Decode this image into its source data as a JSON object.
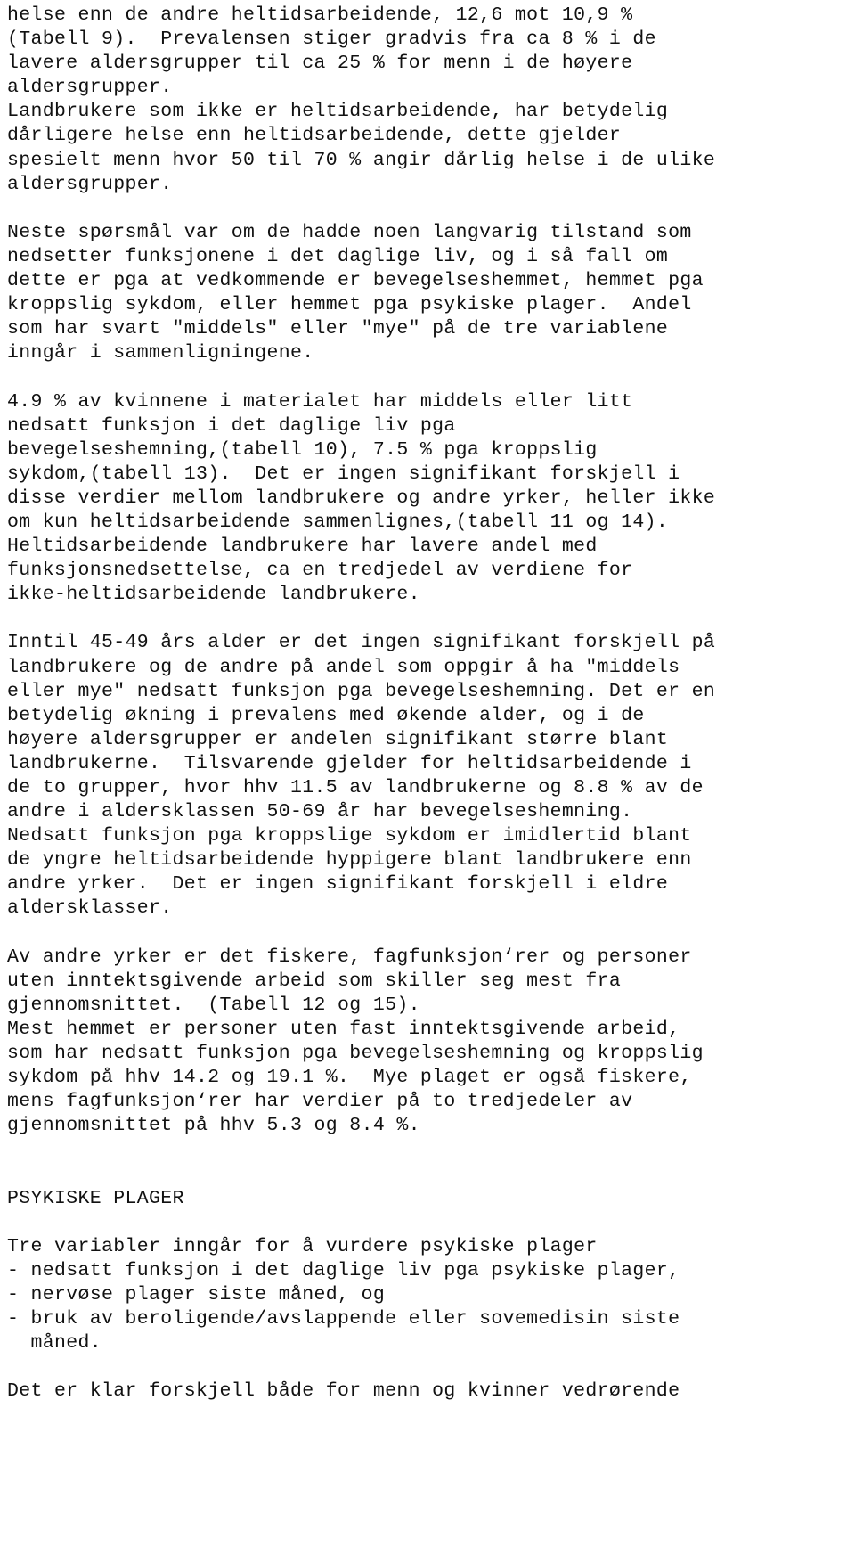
{
  "document": {
    "type": "scanned-report-page",
    "language": "no",
    "section_heading": "PSYKISKE PLAGER",
    "lines": [
      "helse enn de andre heltidsarbeidende, 12,6 mot 10,9 %",
      "(Tabell 9).  Prevalensen stiger gradvis fra ca 8 % i de",
      "lavere aldersgrupper til ca 25 % for menn i de høyere",
      "aldersgrupper.",
      "Landbrukere som ikke er heltidsarbeidende, har betydelig",
      "dårligere helse enn heltidsarbeidende, dette gjelder",
      "spesielt menn hvor 50 til 70 % angir dårlig helse i de ulike",
      "aldersgrupper.",
      "",
      "Neste spørsmål var om de hadde noen langvarig tilstand som",
      "nedsetter funksjonene i det daglige liv, og i så fall om",
      "dette er pga at vedkommende er bevegelseshemmet, hemmet pga",
      "kroppslig sykdom, eller hemmet pga psykiske plager.  Andel",
      "som har svart \"middels\" eller \"mye\" på de tre variablene",
      "inngår i sammenligningene.",
      "",
      "4.9 % av kvinnene i materialet har middels eller litt",
      "nedsatt funksjon i det daglige liv pga",
      "bevegelseshemning,(tabell 10), 7.5 % pga kroppslig",
      "sykdom,(tabell 13).  Det er ingen signifikant forskjell i",
      "disse verdier mellom landbrukere og andre yrker, heller ikke",
      "om kun heltidsarbeidende sammenlignes,(tabell 11 og 14).",
      "Heltidsarbeidende landbrukere har lavere andel med",
      "funksjonsnedsettelse, ca en tredjedel av verdiene for",
      "ikke-heltidsarbeidende landbrukere.",
      "",
      "Inntil 45-49 års alder er det ingen signifikant forskjell på",
      "landbrukere og de andre på andel som oppgir å ha \"middels",
      "eller mye\" nedsatt funksjon pga bevegelseshemning. Det er en",
      "betydelig økning i prevalens med økende alder, og i de",
      "høyere aldersgrupper er andelen signifikant større blant",
      "landbrukerne.  Tilsvarende gjelder for heltidsarbeidende i",
      "de to grupper, hvor hhv 11.5 av landbrukerne og 8.8 % av de",
      "andre i aldersklassen 50-69 år har bevegelseshemning.",
      "Nedsatt funksjon pga kroppslige sykdom er imidlertid blant",
      "de yngre heltidsarbeidende hyppigere blant landbrukere enn",
      "andre yrker.  Det er ingen signifikant forskjell i eldre",
      "aldersklasser.",
      "",
      "Av andre yrker er det fiskere, fagfunksjon‘rer og personer",
      "uten inntektsgivende arbeid som skiller seg mest fra",
      "gjennomsnittet.  (Tabell 12 og 15).",
      "Mest hemmet er personer uten fast inntektsgivende arbeid,",
      "som har nedsatt funksjon pga bevegelseshemning og kroppslig",
      "sykdom på hhv 14.2 og 19.1 %.  Mye plaget er også fiskere,",
      "mens fagfunksjon‘rer har verdier på to tredjedeler av",
      "gjennomsnittet på hhv 5.3 og 8.4 %.",
      "",
      "",
      "PSYKISKE PLAGER",
      "",
      "Tre variabler inngår for å vurdere psykiske plager",
      "- nedsatt funksjon i det daglige liv pga psykiske plager,",
      "- nervøse plager siste måned, og",
      "- bruk av beroligende/avslappende eller sovemedisin siste",
      "  måned.",
      "",
      "Det er klar forskjell både for menn og kvinner vedrørende"
    ]
  }
}
